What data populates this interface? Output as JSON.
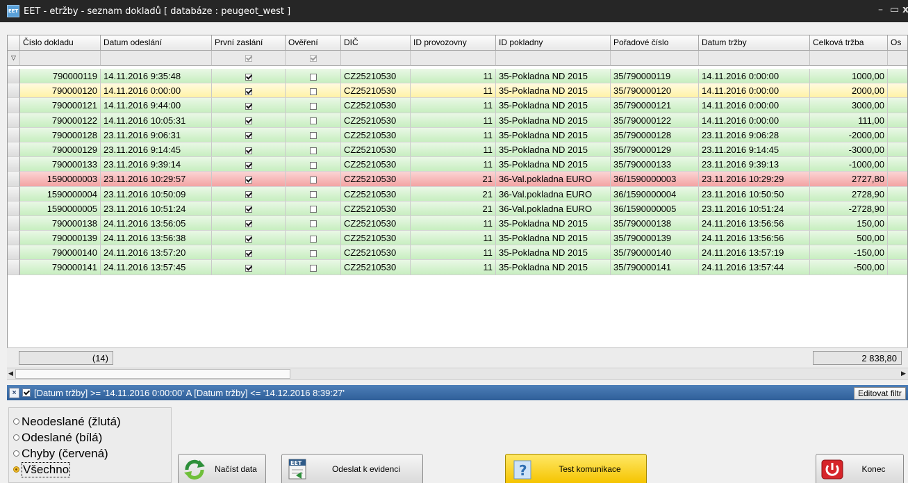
{
  "window": {
    "title": "EET - etržby - seznam dokladů [ databáze : peugeot_west ]",
    "icon_text": "EET",
    "controls": {
      "minimize": "–",
      "maximize": "▭",
      "close": "x"
    }
  },
  "grid": {
    "columns": [
      {
        "label": "Číslo dokladu"
      },
      {
        "label": "Datum odeslání"
      },
      {
        "label": "První zaslání"
      },
      {
        "label": "Ověření"
      },
      {
        "label": "DIČ"
      },
      {
        "label": "ID provozovny"
      },
      {
        "label": "ID pokladny"
      },
      {
        "label": "Pořadové číslo"
      },
      {
        "label": "Datum tržby"
      },
      {
        "label": "Celková tržba"
      },
      {
        "label": "Os"
      }
    ],
    "rows": [
      {
        "status": "green",
        "cislo": "790000119",
        "datum_odeslani": "14.11.2016 9:35:48",
        "prvni": true,
        "overeni": false,
        "dic": "CZ25210530",
        "provozovna": "11",
        "pokladna": "35-Pokladna ND 2015",
        "poradove": "35/790000119",
        "datum_trzby": "14.11.2016 0:00:00",
        "trzba": "1000,00"
      },
      {
        "status": "yellow",
        "cislo": "790000120",
        "datum_odeslani": "14.11.2016 0:00:00",
        "prvni": true,
        "overeni": false,
        "dic": "CZ25210530",
        "provozovna": "11",
        "pokladna": "35-Pokladna ND 2015",
        "poradove": "35/790000120",
        "datum_trzby": "14.11.2016 0:00:00",
        "trzba": "2000,00"
      },
      {
        "status": "green",
        "cislo": "790000121",
        "datum_odeslani": "14.11.2016 9:44:00",
        "prvni": true,
        "overeni": false,
        "dic": "CZ25210530",
        "provozovna": "11",
        "pokladna": "35-Pokladna ND 2015",
        "poradove": "35/790000121",
        "datum_trzby": "14.11.2016 0:00:00",
        "trzba": "3000,00"
      },
      {
        "status": "green",
        "cislo": "790000122",
        "datum_odeslani": "14.11.2016 10:05:31",
        "prvni": true,
        "overeni": false,
        "dic": "CZ25210530",
        "provozovna": "11",
        "pokladna": "35-Pokladna ND 2015",
        "poradove": "35/790000122",
        "datum_trzby": "14.11.2016 0:00:00",
        "trzba": "111,00"
      },
      {
        "status": "green",
        "cislo": "790000128",
        "datum_odeslani": "23.11.2016 9:06:31",
        "prvni": true,
        "overeni": false,
        "dic": "CZ25210530",
        "provozovna": "11",
        "pokladna": "35-Pokladna ND 2015",
        "poradove": "35/790000128",
        "datum_trzby": "23.11.2016 9:06:28",
        "trzba": "-2000,00"
      },
      {
        "status": "green",
        "cislo": "790000129",
        "datum_odeslani": "23.11.2016 9:14:45",
        "prvni": true,
        "overeni": false,
        "dic": "CZ25210530",
        "provozovna": "11",
        "pokladna": "35-Pokladna ND 2015",
        "poradove": "35/790000129",
        "datum_trzby": "23.11.2016 9:14:45",
        "trzba": "-3000,00"
      },
      {
        "status": "green",
        "cislo": "790000133",
        "datum_odeslani": "23.11.2016 9:39:14",
        "prvni": true,
        "overeni": false,
        "dic": "CZ25210530",
        "provozovna": "11",
        "pokladna": "35-Pokladna ND 2015",
        "poradove": "35/790000133",
        "datum_trzby": "23.11.2016 9:39:13",
        "trzba": "-1000,00"
      },
      {
        "status": "red",
        "cislo": "1590000003",
        "datum_odeslani": "23.11.2016 10:29:57",
        "prvni": true,
        "overeni": false,
        "dic": "CZ25210530",
        "provozovna": "21",
        "pokladna": "36-Val.pokladna EURO",
        "poradove": "36/1590000003",
        "datum_trzby": "23.11.2016 10:29:29",
        "trzba": "2727,80"
      },
      {
        "status": "green",
        "cislo": "1590000004",
        "datum_odeslani": "23.11.2016 10:50:09",
        "prvni": true,
        "overeni": false,
        "dic": "CZ25210530",
        "provozovna": "21",
        "pokladna": "36-Val.pokladna EURO",
        "poradove": "36/1590000004",
        "datum_trzby": "23.11.2016 10:50:50",
        "trzba": "2728,90"
      },
      {
        "status": "green",
        "cislo": "1590000005",
        "datum_odeslani": "23.11.2016 10:51:24",
        "prvni": true,
        "overeni": false,
        "dic": "CZ25210530",
        "provozovna": "21",
        "pokladna": "36-Val.pokladna EURO",
        "poradove": "36/1590000005",
        "datum_trzby": "23.11.2016 10:51:24",
        "trzba": "-2728,90"
      },
      {
        "status": "green",
        "cislo": "790000138",
        "datum_odeslani": "24.11.2016 13:56:05",
        "prvni": true,
        "overeni": false,
        "dic": "CZ25210530",
        "provozovna": "11",
        "pokladna": "35-Pokladna ND 2015",
        "poradove": "35/790000138",
        "datum_trzby": "24.11.2016 13:56:56",
        "trzba": "150,00"
      },
      {
        "status": "green",
        "cislo": "790000139",
        "datum_odeslani": "24.11.2016 13:56:38",
        "prvni": true,
        "overeni": false,
        "dic": "CZ25210530",
        "provozovna": "11",
        "pokladna": "35-Pokladna ND 2015",
        "poradove": "35/790000139",
        "datum_trzby": "24.11.2016 13:56:56",
        "trzba": "500,00"
      },
      {
        "status": "green",
        "cislo": "790000140",
        "datum_odeslani": "24.11.2016 13:57:20",
        "prvni": true,
        "overeni": false,
        "dic": "CZ25210530",
        "provozovna": "11",
        "pokladna": "35-Pokladna ND 2015",
        "poradove": "35/790000140",
        "datum_trzby": "24.11.2016 13:57:19",
        "trzba": "-150,00"
      },
      {
        "status": "green",
        "cislo": "790000141",
        "datum_odeslani": "24.11.2016 13:57:45",
        "prvni": true,
        "overeni": false,
        "dic": "CZ25210530",
        "provozovna": "11",
        "pokladna": "35-Pokladna ND 2015",
        "poradove": "35/790000141",
        "datum_trzby": "24.11.2016 13:57:44",
        "trzba": "-500,00"
      }
    ],
    "footer": {
      "count": "(14)",
      "total": "2 838,80"
    },
    "status_colors": {
      "green": "#c7eec0",
      "yellow": "#fff2a6",
      "red": "#f3a3a3"
    }
  },
  "scrollbar": {
    "left_arrow": "◀",
    "right_arrow": "▶"
  },
  "filter": {
    "close_icon": "×",
    "expression": "[Datum tržby] >= '14.11.2016 0:00:00' A [Datum tržby] <= '14.12.2016 8:39:27'",
    "edit_label": "Editovat filtr"
  },
  "status_filter": {
    "options": [
      {
        "label": "Neodeslané (žlutá)",
        "selected": false
      },
      {
        "label": "Odeslané (bílá)",
        "selected": false
      },
      {
        "label": "Chyby (červená)",
        "selected": false
      },
      {
        "label": "Všechno",
        "selected": true
      }
    ]
  },
  "buttons": {
    "load_label": "Načíst data",
    "send_label": "Odeslat k evidenci",
    "send_icon_text": "EET",
    "test_label": "Test komunikace",
    "test_icon_text": "?",
    "exit_label": "Konec"
  }
}
